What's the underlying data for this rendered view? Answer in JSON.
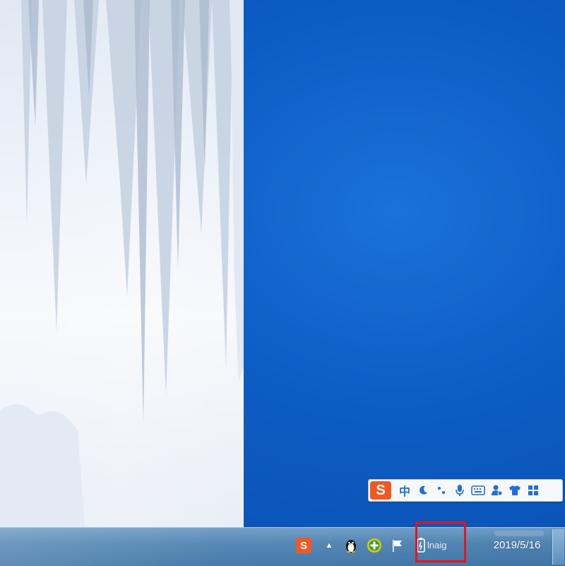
{
  "desktop": {
    "wallpaper": "icicles-over-blue-sky",
    "accent_color": "#0a5ec6"
  },
  "ime_bar": {
    "logo_letter": "S",
    "mode_label": "中",
    "icons": [
      "moon-icon",
      "punctuation-icon",
      "microphone-icon",
      "keyboard-icon",
      "user-icon",
      "shirt-icon",
      "grid-icon"
    ]
  },
  "taskbar": {
    "tray": {
      "sogou_letter": "S",
      "show_hidden_arrow": "▲",
      "icons": [
        "qq-penguin-icon",
        "plus-circle-icon",
        "flag-icon",
        "power-plug-icon"
      ]
    },
    "lang_indicator": "lnaig",
    "clock_date": "2019/5/16"
  },
  "annotation": {
    "color": "#e8141b"
  }
}
